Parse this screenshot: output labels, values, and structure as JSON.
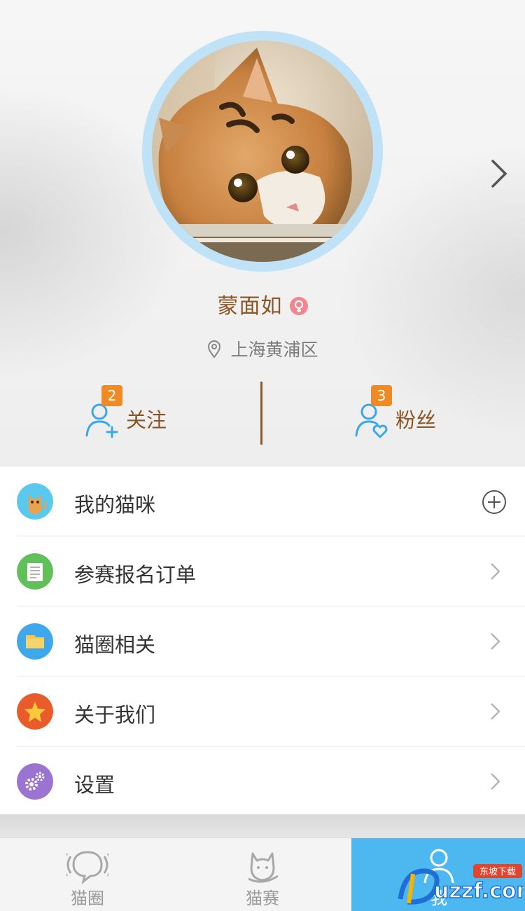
{
  "profile": {
    "username": "蒙面如",
    "gender_icon": "female-icon",
    "location": "上海黄浦区",
    "avatar": "cat-photo"
  },
  "stats": {
    "follow": {
      "label": "关注",
      "count": "2"
    },
    "fans": {
      "label": "粉丝",
      "count": "3"
    }
  },
  "menu": {
    "items": [
      {
        "label": "我的猫咪",
        "icon": "cat-icon",
        "accent": "#5bc8ee",
        "action": "plus"
      },
      {
        "label": "参赛报名订单",
        "icon": "document-icon",
        "accent": "#62c05a",
        "action": "chevron"
      },
      {
        "label": "猫圈相关",
        "icon": "folder-icon",
        "accent": "#3fa8ec",
        "action": "chevron"
      },
      {
        "label": "关于我们",
        "icon": "star-icon",
        "accent": "#ea5b2c",
        "action": "chevron"
      },
      {
        "label": "设置",
        "icon": "gear-icon",
        "accent": "#9b74d2",
        "action": "chevron"
      }
    ]
  },
  "tabbar": {
    "tabs": [
      {
        "label": "猫圈",
        "icon": "circle-chat-icon",
        "active": false
      },
      {
        "label": "猫赛",
        "icon": "cat-head-icon",
        "active": false
      },
      {
        "label": "我",
        "icon": "person-icon",
        "active": true
      }
    ],
    "active_color": "#4db8f0"
  },
  "watermark": {
    "text": "uzzf.com",
    "tagline": "东坡下载"
  },
  "colors": {
    "brand_brown": "#8a5524",
    "badge_orange": "#f08a24"
  }
}
